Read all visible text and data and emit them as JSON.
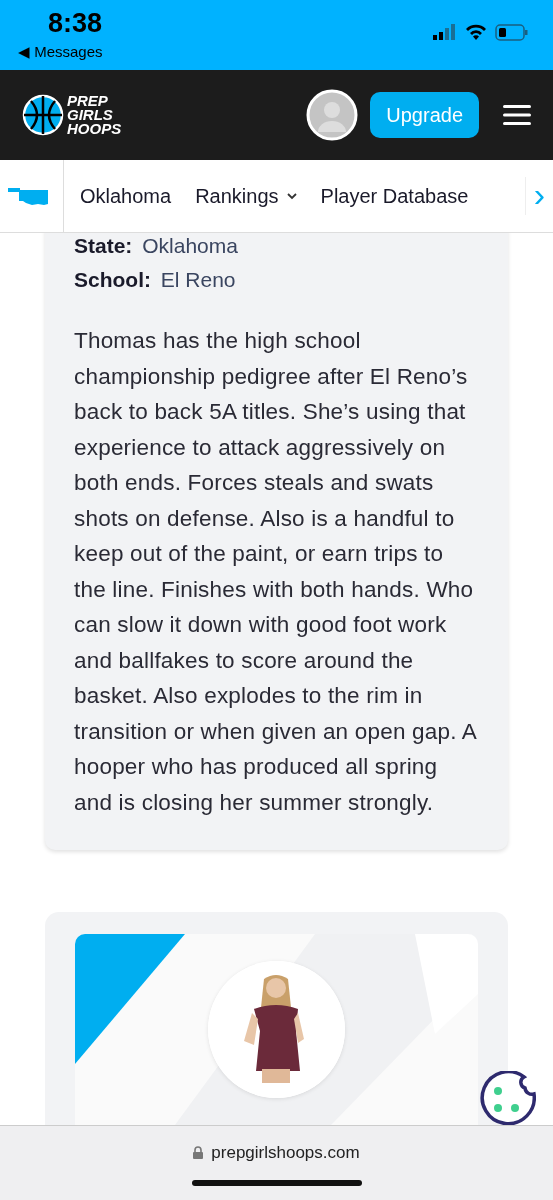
{
  "status_bar": {
    "time": "8:38",
    "back_label": "◀ Messages"
  },
  "header": {
    "logo_lines": [
      "PREP",
      "GIRLS",
      "HOOPS"
    ],
    "upgrade_button": "Upgrade"
  },
  "nav": {
    "items": [
      {
        "label": "Oklahoma",
        "dropdown": false
      },
      {
        "label": "Rankings",
        "dropdown": true
      },
      {
        "label": "Player Database",
        "dropdown": false
      }
    ],
    "next": "›"
  },
  "profile_card": {
    "fields": [
      {
        "label": "State:",
        "value": "Oklahoma"
      },
      {
        "label": "School:",
        "value": "El Reno"
      }
    ],
    "bio": "Thomas has the high school championship pedigree after El Reno’s back to back 5A titles. She’s using that experience to attack aggressively on both ends. Forces steals and swats shots on defense. Also is a handful to keep out of the paint, or earn trips to the line. Finishes with both hands. Who can slow it down with good foot work and ballfakes to score around the basket. Also explodes to the rim in transition or when given an open gap. A hooper who has produced all spring and is closing her summer strongly."
  },
  "browser_bar": {
    "url": "prepgirlshoops.com"
  }
}
